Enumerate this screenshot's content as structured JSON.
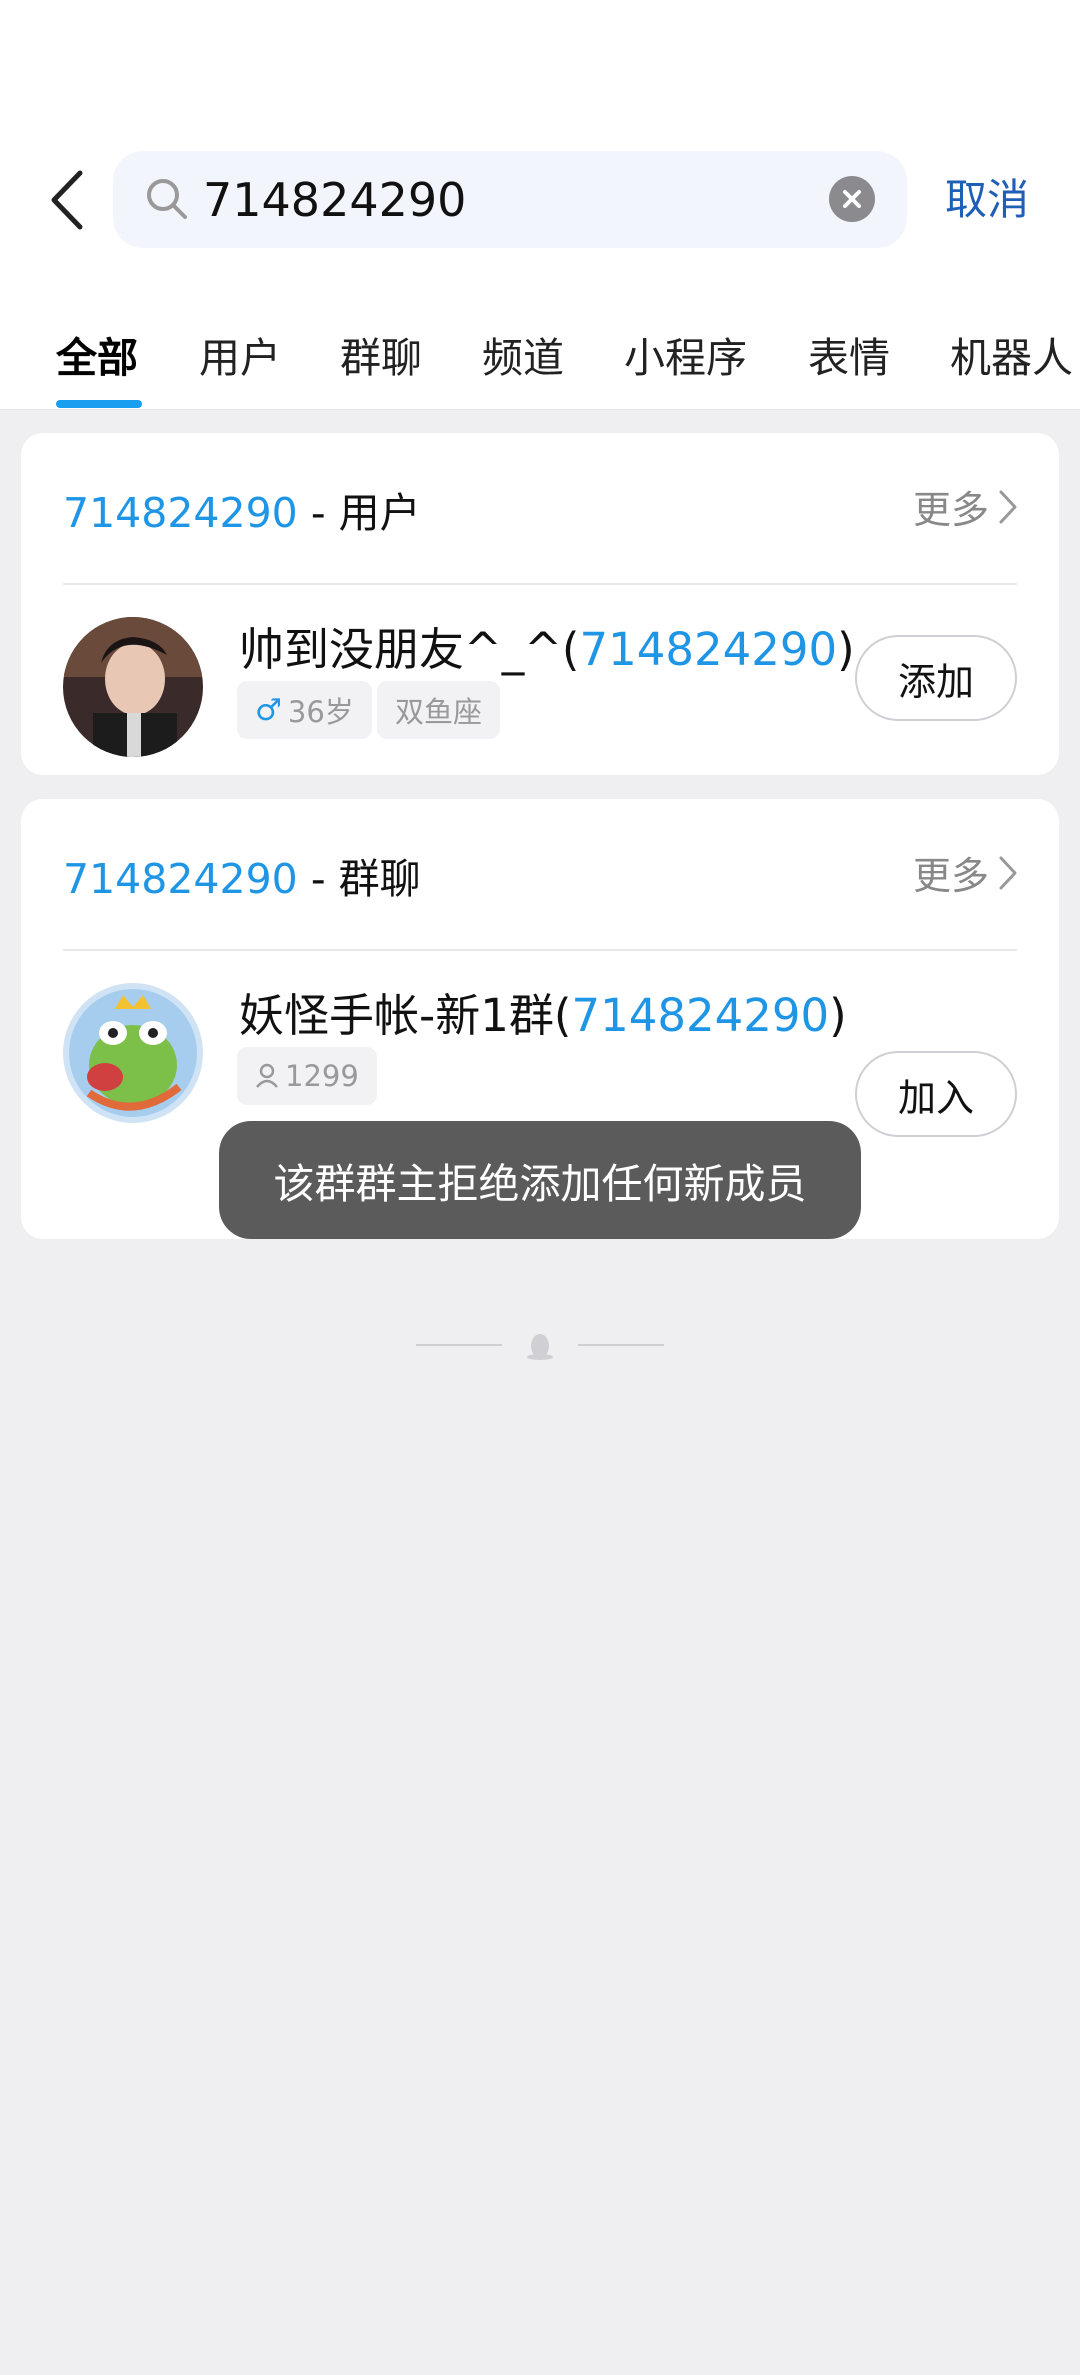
{
  "search": {
    "query": "714824290",
    "cancel_label": "取消"
  },
  "tabs": [
    {
      "label": "全部"
    },
    {
      "label": "用户"
    },
    {
      "label": "群聊"
    },
    {
      "label": "频道"
    },
    {
      "label": "小程序"
    },
    {
      "label": "表情"
    },
    {
      "label": "机器人"
    }
  ],
  "user_section": {
    "query": "714824290",
    "title_suffix": "- 用户",
    "more_label": "更多",
    "name_prefix": "帅到没朋友^_^(",
    "name_id": "714824290",
    "name_suffix": ")",
    "tags": [
      {
        "label": "36岁"
      },
      {
        "label": "双鱼座"
      }
    ],
    "action_label": "添加"
  },
  "group_section": {
    "query": "714824290",
    "title_suffix": "- 群聊",
    "more_label": "更多",
    "name_prefix": "妖怪手帐-新1群(",
    "name_id": "714824290",
    "name_suffix": ")",
    "member_count": "1299",
    "action_label": "加入"
  },
  "toast": {
    "message": "该群群主拒绝添加任何新成员"
  },
  "colors": {
    "accent": "#1f95e6",
    "cancel": "#1f5fb4",
    "indicator": "#1a9ff0"
  }
}
